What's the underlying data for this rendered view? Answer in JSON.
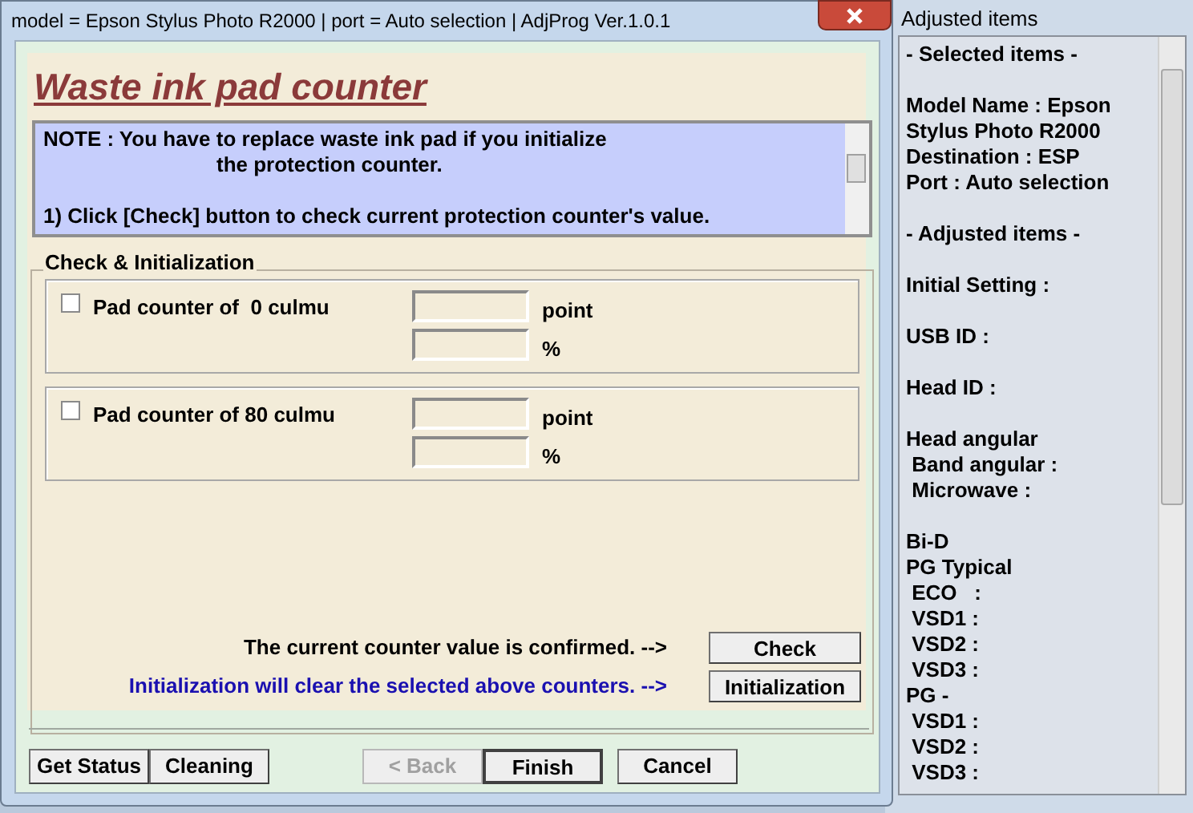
{
  "window": {
    "title": "model = Epson Stylus Photo R2000 | port = Auto selection | AdjProg Ver.1.0.1"
  },
  "heading": "Waste ink pad counter",
  "note": {
    "lines": [
      {
        "text": "NOTE : You have to replace waste ink pad if you initialize",
        "kind": "plain"
      },
      {
        "text": "the protection counter.",
        "kind": "indent"
      },
      {
        "text": "1) Click [Check] button to check current protection counter's value.",
        "kind": "gap"
      }
    ]
  },
  "group": {
    "title": "Check & Initialization",
    "counters": [
      {
        "label": "Pad counter of  0 culmu",
        "checked": false,
        "units": [
          "point",
          "%"
        ]
      },
      {
        "label": "Pad counter of 80 culmu",
        "checked": false,
        "units": [
          "point",
          "%"
        ]
      }
    ],
    "actions": [
      {
        "text": "The current counter value is confirmed. -->",
        "kind": "plain",
        "button": "Check"
      },
      {
        "text": "Initialization will clear the selected above counters. -->",
        "kind": "highlight",
        "button": "Initialization"
      }
    ]
  },
  "footer_buttons": [
    {
      "label": "Get Status",
      "disabled": false,
      "default": false,
      "kind": "left"
    },
    {
      "label": "Cleaning",
      "disabled": false,
      "default": false,
      "kind": "left"
    },
    {
      "label": "< Back",
      "disabled": true,
      "default": false,
      "kind": "nav"
    },
    {
      "label": "Finish",
      "disabled": false,
      "default": true,
      "kind": "nav"
    },
    {
      "label": "Cancel",
      "disabled": false,
      "default": false,
      "kind": "cancel"
    }
  ],
  "side_panel": {
    "title": "Adjusted items",
    "blocks": [
      [
        "- Selected items -"
      ],
      [
        "Model Name : Epson",
        "Stylus Photo R2000",
        "Destination : ESP",
        "Port : Auto selection"
      ],
      [
        "- Adjusted items -"
      ],
      [
        "Initial Setting :"
      ],
      [
        "USB ID :"
      ],
      [
        "Head ID :"
      ],
      [
        "Head angular",
        " Band angular :",
        " Microwave :"
      ],
      [
        "Bi-D",
        "PG Typical",
        " ECO   :",
        " VSD1 :",
        " VSD2 :",
        " VSD3 :",
        "PG -",
        " VSD1 :",
        " VSD2 :",
        " VSD3 :"
      ]
    ]
  }
}
